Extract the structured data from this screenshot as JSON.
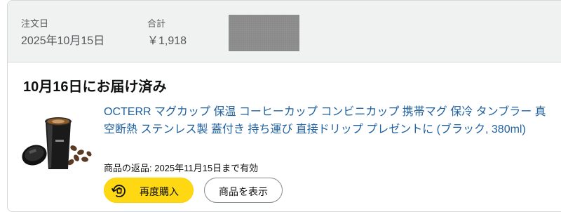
{
  "order": {
    "date_label": "注文日",
    "date_value": "2025年10月15日",
    "total_label": "合計",
    "total_value": "￥1,918"
  },
  "shipment": {
    "status": "10月16日にお届け済み"
  },
  "item": {
    "title": "OCTERR マグカップ 保温 コーヒーカップ コンビニカップ 携帯マグ 保冷 タンブラー 真空断熱 ステンレス製 蓋付き 持ち運び 直接ドリップ プレゼントに (ブラック, 380ml)",
    "return_policy": "商品の返品: 2025年11月15日まで有効",
    "image_icon": "black-tumbler-with-coffee-beans"
  },
  "actions": {
    "buy_again": "再度購入",
    "buy_again_icon": "buy-again-icon",
    "view_item": "商品を表示"
  },
  "colors": {
    "link": "#2162a1",
    "buy_button": "#ffd814",
    "header_bg": "#f0f2f2"
  }
}
